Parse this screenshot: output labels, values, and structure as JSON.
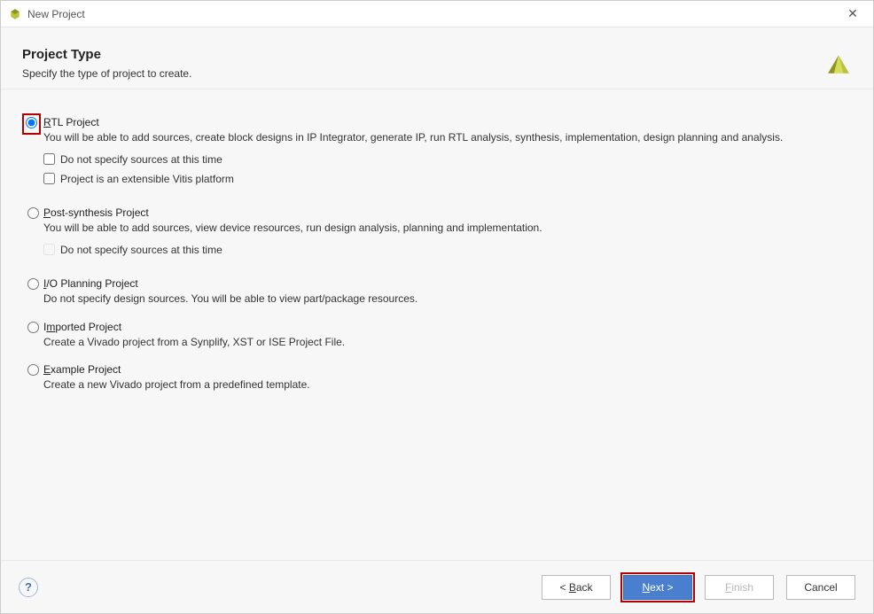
{
  "window": {
    "title": "New Project"
  },
  "header": {
    "title": "Project Type",
    "subtitle": "Specify the type of project to create."
  },
  "options": {
    "rtl": {
      "title_pre": "",
      "title_ul": "R",
      "title_post": "TL Project",
      "desc": "You will be able to add sources, create block designs in IP Integrator, generate IP, run RTL analysis, synthesis, implementation, design planning and analysis.",
      "chk1_pre": "",
      "chk1_ul": "D",
      "chk1_post": "o not specify sources at this time",
      "chk2_pre": "Project is an extensible ",
      "chk2_ul": "V",
      "chk2_post": "itis platform"
    },
    "postsynth": {
      "title_pre": "",
      "title_ul": "P",
      "title_post": "ost-synthesis Project",
      "desc": "You will be able to add sources, view device resources, run design analysis, planning and implementation.",
      "chk_pre": "D",
      "chk_ul": "o",
      "chk_post": " not specify sources at this time"
    },
    "io": {
      "title_pre": "",
      "title_ul": "I",
      "title_post": "/O Planning Project",
      "desc": "Do not specify design sources. You will be able to view part/package resources."
    },
    "imported": {
      "title_pre": "I",
      "title_ul": "m",
      "title_post": "ported Project",
      "desc": "Create a Vivado project from a Synplify, XST or ISE Project File."
    },
    "example": {
      "title_pre": "",
      "title_ul": "E",
      "title_post": "xample Project",
      "desc": "Create a new Vivado project from a predefined template."
    }
  },
  "footer": {
    "help": "?",
    "back_pre": "< ",
    "back_ul": "B",
    "back_post": "ack",
    "next_pre": "",
    "next_ul": "N",
    "next_post": "ext >",
    "finish_pre": "",
    "finish_ul": "F",
    "finish_post": "inish",
    "cancel": "Cancel"
  }
}
